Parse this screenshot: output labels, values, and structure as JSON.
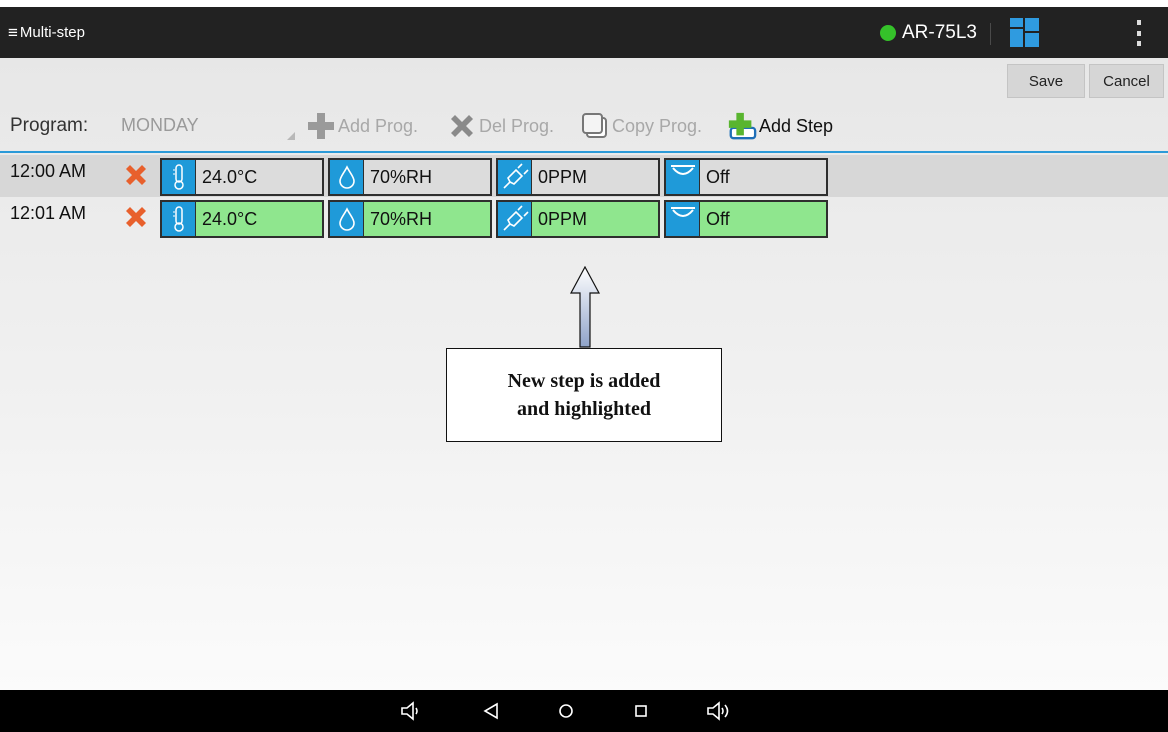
{
  "app": {
    "title": "Multi-step",
    "menu_icon": "hamburger-icon"
  },
  "device": {
    "name": "AR-75L3",
    "status_color": "#35c22a",
    "status": "online"
  },
  "actions": {
    "save_label": "Save",
    "cancel_label": "Cancel"
  },
  "program": {
    "label": "Program:",
    "selected": "MONDAY",
    "toolbar": {
      "add_prog": "Add Prog.",
      "del_prog": "Del Prog.",
      "copy_prog": "Copy Prog.",
      "add_step": "Add Step"
    }
  },
  "steps": [
    {
      "time": "12:00 AM",
      "temp": "24.0°C",
      "humidity": "70%RH",
      "co2": "0PPM",
      "dehumidifier": "Off",
      "highlighted": false
    },
    {
      "time": "12:01 AM",
      "temp": "24.0°C",
      "humidity": "70%RH",
      "co2": "0PPM",
      "dehumidifier": "Off",
      "highlighted": true
    }
  ],
  "callout": {
    "line1": "New step is added",
    "line2": "and highlighted"
  },
  "colors": {
    "accent": "#1f9ad9",
    "highlight": "#8fe68e",
    "topbar": "#222222"
  },
  "navbar": {
    "icons": [
      "volume-down-icon",
      "back-icon",
      "home-icon",
      "recents-icon",
      "volume-up-icon"
    ]
  }
}
